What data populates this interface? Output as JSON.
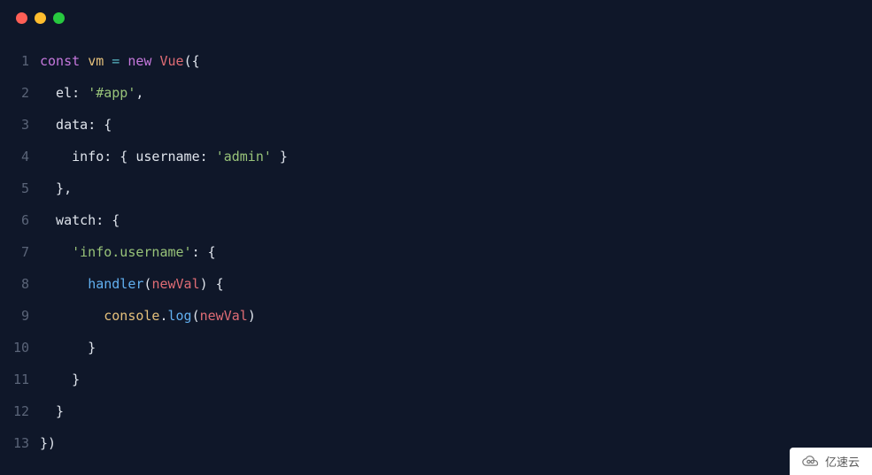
{
  "window": {
    "dots": [
      "red",
      "yellow",
      "green"
    ]
  },
  "code": {
    "lines": [
      {
        "num": "1",
        "tokens": [
          {
            "t": "const",
            "c": "tok-keyword"
          },
          {
            "t": " ",
            "c": "tok-punct"
          },
          {
            "t": "vm",
            "c": "tok-var"
          },
          {
            "t": " ",
            "c": "tok-punct"
          },
          {
            "t": "=",
            "c": "tok-op"
          },
          {
            "t": " ",
            "c": "tok-punct"
          },
          {
            "t": "new",
            "c": "tok-new"
          },
          {
            "t": " ",
            "c": "tok-punct"
          },
          {
            "t": "Vue",
            "c": "tok-class"
          },
          {
            "t": "({",
            "c": "tok-punct"
          }
        ]
      },
      {
        "num": "2",
        "tokens": [
          {
            "t": "  el",
            "c": "tok-prop"
          },
          {
            "t": ": ",
            "c": "tok-punct"
          },
          {
            "t": "'#app'",
            "c": "tok-string"
          },
          {
            "t": ",",
            "c": "tok-punct"
          }
        ]
      },
      {
        "num": "3",
        "tokens": [
          {
            "t": "  data",
            "c": "tok-prop"
          },
          {
            "t": ": {",
            "c": "tok-punct"
          }
        ]
      },
      {
        "num": "4",
        "tokens": [
          {
            "t": "    info",
            "c": "tok-prop"
          },
          {
            "t": ": { ",
            "c": "tok-punct"
          },
          {
            "t": "username",
            "c": "tok-prop"
          },
          {
            "t": ": ",
            "c": "tok-punct"
          },
          {
            "t": "'admin'",
            "c": "tok-string"
          },
          {
            "t": " }",
            "c": "tok-punct"
          }
        ]
      },
      {
        "num": "5",
        "tokens": [
          {
            "t": "  },",
            "c": "tok-punct"
          }
        ]
      },
      {
        "num": "6",
        "tokens": [
          {
            "t": "  watch",
            "c": "tok-prop"
          },
          {
            "t": ": {",
            "c": "tok-punct"
          }
        ]
      },
      {
        "num": "7",
        "tokens": [
          {
            "t": "    ",
            "c": "tok-punct"
          },
          {
            "t": "'info.username'",
            "c": "tok-string"
          },
          {
            "t": ": {",
            "c": "tok-punct"
          }
        ]
      },
      {
        "num": "8",
        "tokens": [
          {
            "t": "      ",
            "c": "tok-punct"
          },
          {
            "t": "handler",
            "c": "tok-method"
          },
          {
            "t": "(",
            "c": "tok-punct"
          },
          {
            "t": "newVal",
            "c": "tok-ident"
          },
          {
            "t": ") {",
            "c": "tok-punct"
          }
        ]
      },
      {
        "num": "9",
        "tokens": [
          {
            "t": "        ",
            "c": "tok-punct"
          },
          {
            "t": "console",
            "c": "tok-obj"
          },
          {
            "t": ".",
            "c": "tok-punct"
          },
          {
            "t": "log",
            "c": "tok-method"
          },
          {
            "t": "(",
            "c": "tok-punct"
          },
          {
            "t": "newVal",
            "c": "tok-ident"
          },
          {
            "t": ")",
            "c": "tok-punct"
          }
        ]
      },
      {
        "num": "10",
        "tokens": [
          {
            "t": "      }",
            "c": "tok-punct"
          }
        ]
      },
      {
        "num": "11",
        "tokens": [
          {
            "t": "    }",
            "c": "tok-punct"
          }
        ]
      },
      {
        "num": "12",
        "tokens": [
          {
            "t": "  }",
            "c": "tok-punct"
          }
        ]
      },
      {
        "num": "13",
        "tokens": [
          {
            "t": "})",
            "c": "tok-punct"
          }
        ]
      }
    ]
  },
  "watermark": {
    "text": "亿速云"
  }
}
